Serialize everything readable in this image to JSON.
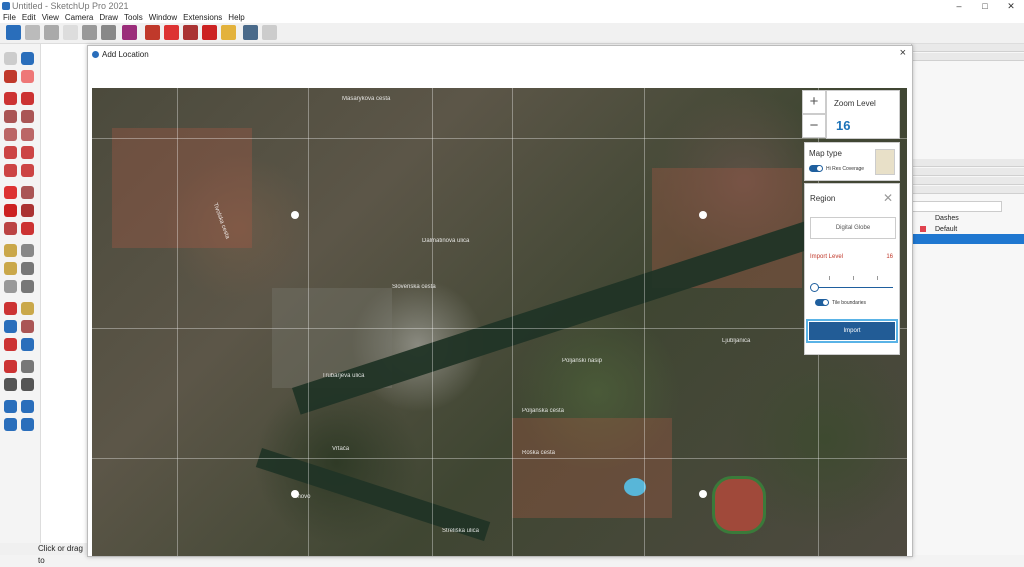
{
  "window": {
    "title": "Untitled - SketchUp Pro 2021"
  },
  "menu": [
    "File",
    "Edit",
    "View",
    "Camera",
    "Draw",
    "Tools",
    "Window",
    "Extensions",
    "Help"
  ],
  "dialog": {
    "title": "Add Location",
    "close": "×",
    "zoom": {
      "plus": "+",
      "minus": "−",
      "label": "Zoom Level",
      "value": "16"
    },
    "map_type": {
      "label": "Map type",
      "toggle_label": "Hi Res Coverage"
    },
    "region": {
      "label": "Region",
      "close": "✕",
      "provider": "Digital Globe",
      "import_level_label": "Import Level",
      "import_level_value": "16",
      "tile_boundaries_label": "Tile boundaries",
      "import_button": "Import"
    },
    "streets": [
      "Masarykova cesta",
      "Tivolska cesta",
      "Slovenska cesta",
      "Dalmatinova ulica",
      "Trubarjeva ulica",
      "Poljanska cesta",
      "Vrtača",
      "Streliška ulica",
      "Roška cesta",
      "Ljubljanica",
      "Poljanski nasip",
      "Trnovo"
    ]
  },
  "tray": {
    "dashes_label": "Dashes",
    "default_label": "Default"
  },
  "status": {
    "text": "Click or drag to"
  },
  "colors": {
    "accent": "#1d73b8",
    "import_button": "#225c96",
    "import_level": "#c0392b",
    "swatch": "#e0434f"
  }
}
